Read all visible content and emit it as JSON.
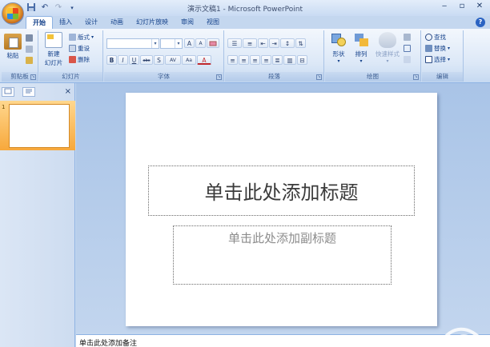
{
  "window": {
    "title": "演示文稿1 - Microsoft PowerPoint"
  },
  "qat": {
    "save_icon": "save-icon",
    "undo_icon": "undo-icon",
    "redo_icon": "redo-icon",
    "customize_icon": "customize-qat-icon"
  },
  "tabs": [
    {
      "label": "开始",
      "active": true
    },
    {
      "label": "插入"
    },
    {
      "label": "设计"
    },
    {
      "label": "动画"
    },
    {
      "label": "幻灯片放映"
    },
    {
      "label": "审阅"
    },
    {
      "label": "视图"
    }
  ],
  "ribbon": {
    "clipboard": {
      "label": "剪贴板",
      "paste": "粘贴"
    },
    "slides": {
      "label": "幻灯片",
      "new_slide_1": "新建",
      "new_slide_2": "幻灯片",
      "layout": "版式",
      "reset": "重设",
      "delete": "删除"
    },
    "font": {
      "label": "字体",
      "font_name": "",
      "font_size": "",
      "grow": "A",
      "shrink": "A",
      "clear": "",
      "bold": "B",
      "italic": "I",
      "underline": "U",
      "strike": "abc",
      "shadow": "S",
      "spacing": "AV",
      "case": "Aa",
      "color": "A"
    },
    "paragraph": {
      "label": "段落"
    },
    "drawing": {
      "label": "绘图",
      "shape": "形状",
      "arrange": "排列",
      "quick_styles": "快速样式"
    },
    "editing": {
      "label": "编辑",
      "find": "查找",
      "replace": "替换",
      "select": "选择"
    }
  },
  "left_panel": {
    "tab_slides": "",
    "tab_outline": "",
    "close": "×",
    "slide_number": "1"
  },
  "slide": {
    "title_placeholder": "单击此处添加标题",
    "subtitle_placeholder": "单击此处添加副标题"
  },
  "notes": {
    "placeholder": "单击此处添加备注"
  },
  "colors": {
    "ribbon_bg": "#dce8f7",
    "accent": "#15428b",
    "selected_slide": "#f7a83b"
  }
}
